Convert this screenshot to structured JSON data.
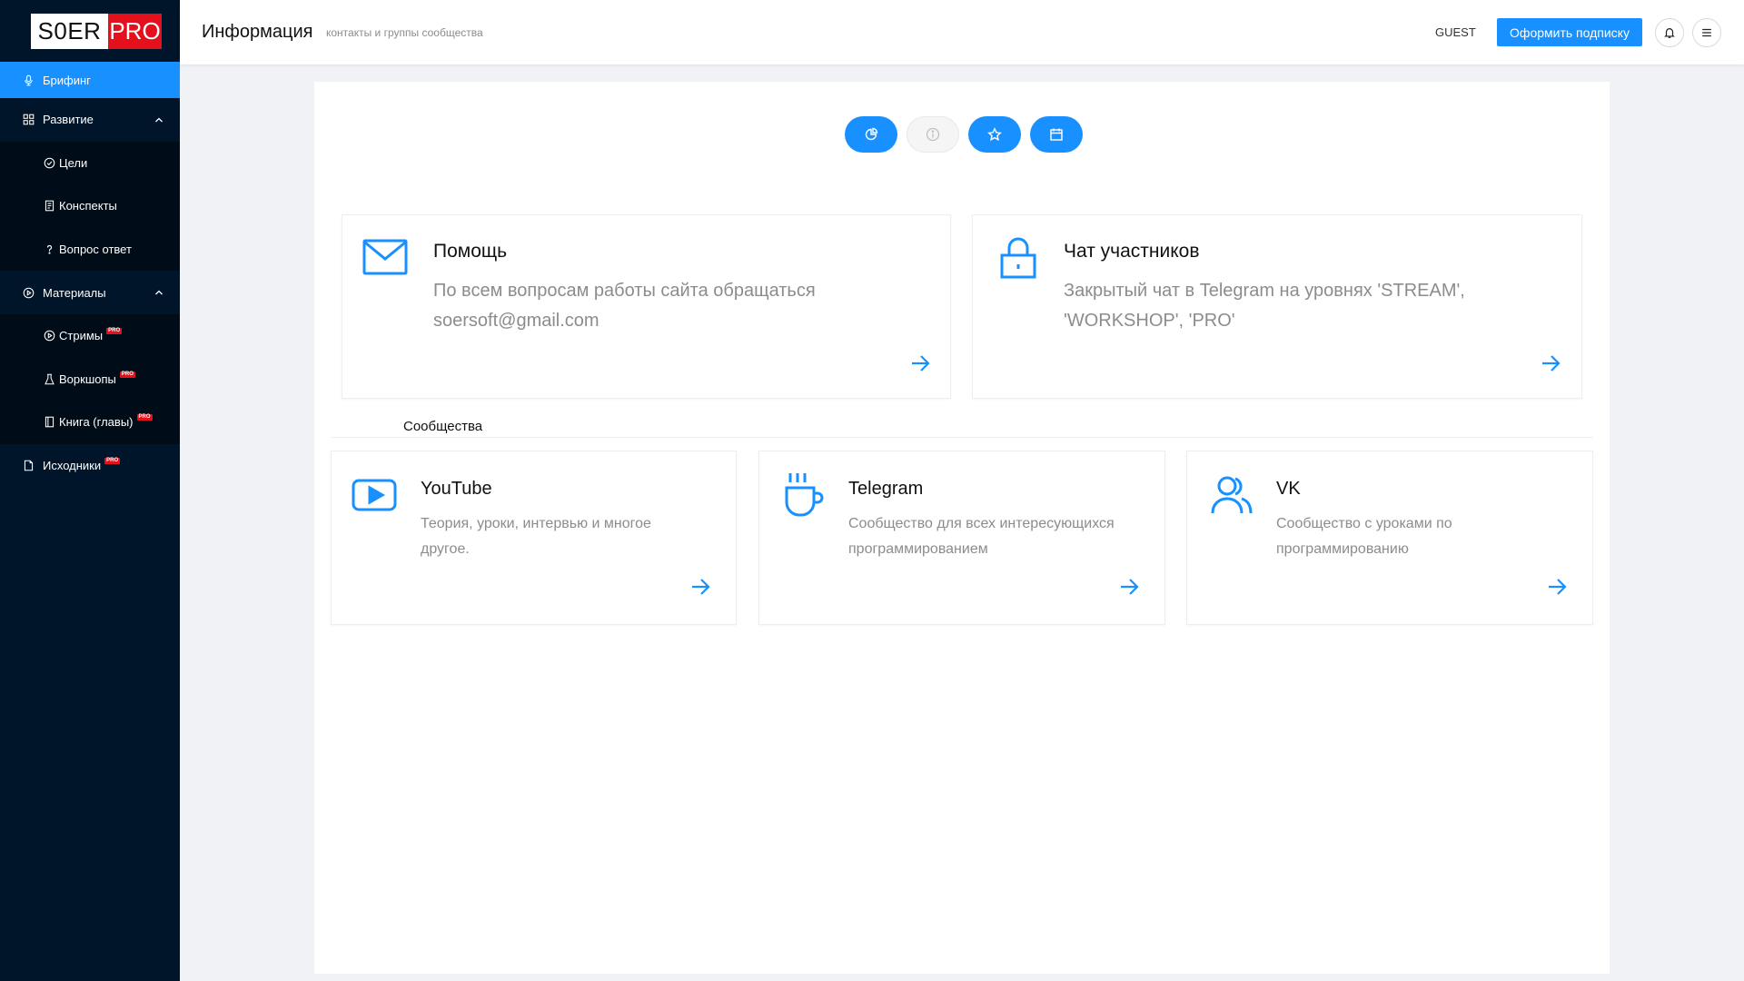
{
  "logo": {
    "left": "S0ER",
    "right": "PRO"
  },
  "sidebar": {
    "items": [
      {
        "label": "Брифинг",
        "icon": "microphone-icon",
        "active": true
      },
      {
        "label": "Развитие",
        "icon": "appstore-icon",
        "expanded": true,
        "children": [
          {
            "label": "Цели",
            "icon": "check-circle-icon"
          },
          {
            "label": "Конспекты",
            "icon": "notebook-icon"
          },
          {
            "label": "Вопрос ответ",
            "icon": "question-icon"
          }
        ]
      },
      {
        "label": "Материалы",
        "icon": "play-circle-icon",
        "expanded": true,
        "children": [
          {
            "label": "Стримы",
            "icon": "play-circle-icon",
            "badge": "PRO"
          },
          {
            "label": "Воркшопы",
            "icon": "experiment-icon",
            "badge": "PRO"
          },
          {
            "label": "Книга (главы)",
            "icon": "book-icon",
            "badge": "PRO"
          }
        ]
      },
      {
        "label": "Исходники",
        "icon": "file-icon",
        "badge": "PRO"
      }
    ]
  },
  "header": {
    "title": "Информация",
    "subtitle": "контакты и группы сообщества",
    "user": "GUEST",
    "subscribe_label": "Оформить подписку"
  },
  "tabs": [
    {
      "icon": "pie-chart-icon",
      "active": true
    },
    {
      "icon": "info-circle-icon",
      "active": false
    },
    {
      "icon": "star-icon",
      "active": true
    },
    {
      "icon": "calendar-icon",
      "active": true
    }
  ],
  "contact_cards": [
    {
      "title": "Помощь",
      "desc_line1": "По всем вопросам работы сайта обращаться",
      "desc_line2": "soersoft@gmail.com",
      "icon": "mail-icon"
    },
    {
      "title": "Чат участников",
      "desc_line1": "Закрытый чат в Telegram на уровнях 'STREAM',",
      "desc_line2": "'WORKSHOP', 'PRO'",
      "icon": "lock-icon"
    }
  ],
  "section_label": "Сообщества",
  "community_cards": [
    {
      "title": "YouTube",
      "desc_line1": "Теория, уроки, интервью и многое",
      "desc_line2": "другое.",
      "icon": "youtube-icon"
    },
    {
      "title": "Telegram",
      "desc_line1": "Сообщество для всех интересующихся",
      "desc_line2": "программированием",
      "icon": "coffee-icon"
    },
    {
      "title": "VK",
      "desc_line1": "Сообщество с уроками по",
      "desc_line2": "программированию",
      "icon": "team-icon"
    }
  ],
  "colors": {
    "accent": "#1890ff",
    "sidebar": "#001529",
    "submenu": "#000c17",
    "brand_red": "#e4101c"
  }
}
